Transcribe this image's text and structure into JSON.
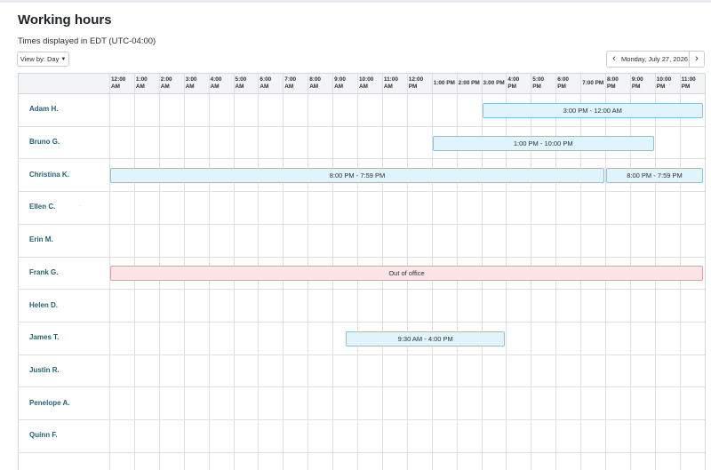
{
  "page": {
    "title": "Working hours",
    "timezone_note": "Times displayed in EDT (UTC-04:00)"
  },
  "toolbar": {
    "view_by_label": "View by: Day",
    "current_date": "Monday, July 27, 2026"
  },
  "hours": [
    [
      "12:00",
      "AM"
    ],
    [
      "1:00",
      "AM"
    ],
    [
      "2:00",
      "AM"
    ],
    [
      "3:00",
      "AM"
    ],
    [
      "4:00",
      "AM"
    ],
    [
      "5:00",
      "AM"
    ],
    [
      "6:00",
      "AM"
    ],
    [
      "7:00",
      "AM"
    ],
    [
      "8:00",
      "AM"
    ],
    [
      "9:00",
      "AM"
    ],
    [
      "10:00",
      "AM"
    ],
    [
      "11:00",
      "AM"
    ],
    [
      "12:00",
      "PM"
    ],
    [
      "1:00 PM",
      ""
    ],
    [
      "2:00 PM",
      ""
    ],
    [
      "3:00 PM",
      ""
    ],
    [
      "4:00",
      "PM"
    ],
    [
      "5:00",
      "PM"
    ],
    [
      "6:00",
      "PM"
    ],
    [
      "7:00 PM",
      ""
    ],
    [
      "8:00",
      "PM"
    ],
    [
      "9:00",
      "PM"
    ],
    [
      "10:00",
      "PM"
    ],
    [
      "11:00",
      "PM"
    ]
  ],
  "people": [
    {
      "name": "Adam H.",
      "blocks": [
        {
          "start": 15,
          "end": 24,
          "label": "3:00 PM - 12:00 AM",
          "kind": "work"
        }
      ]
    },
    {
      "name": "Bruno G.",
      "blocks": [
        {
          "start": 13,
          "end": 22,
          "label": "1:00 PM - 10:00 PM",
          "kind": "work"
        }
      ]
    },
    {
      "name": "Christina K.",
      "blocks": [
        {
          "start": 0,
          "end": 20,
          "label": "8:00 PM - 7:59 PM",
          "kind": "work"
        },
        {
          "start": 20,
          "end": 24,
          "label": "8:00 PM - 7:59 PM",
          "kind": "work"
        }
      ]
    },
    {
      "name": "Ellen C.",
      "blocks": []
    },
    {
      "name": "Erin M.",
      "blocks": []
    },
    {
      "name": "Frank G.",
      "blocks": [
        {
          "start": 0,
          "end": 24,
          "label": "Out of office",
          "kind": "ooo"
        }
      ]
    },
    {
      "name": "Helen D.",
      "blocks": []
    },
    {
      "name": "James T.",
      "blocks": [
        {
          "start": 9.5,
          "end": 16,
          "label": "9:30 AM - 4:00 PM",
          "kind": "work"
        }
      ]
    },
    {
      "name": "Justin R.",
      "blocks": []
    },
    {
      "name": "Penelope A.",
      "blocks": []
    },
    {
      "name": "Quinn F.",
      "blocks": []
    }
  ]
}
